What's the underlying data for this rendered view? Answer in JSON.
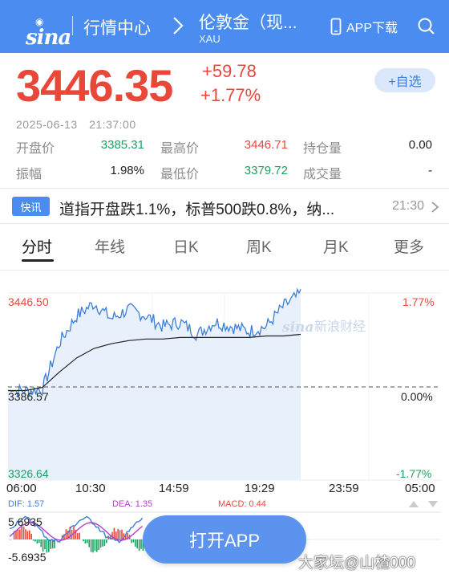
{
  "header": {
    "logo_text": "sina",
    "section_title": "行情中心",
    "stock_name": "伦敦金（现...",
    "stock_code": "XAU",
    "app_download_label": "APP下载"
  },
  "quote": {
    "price": "3446.35",
    "change": "+59.78",
    "change_pct": "+1.77%",
    "add_watch_label": "+自选",
    "timestamp": "2025-06-13　21:37:00",
    "stats": {
      "open_label": "开盘价",
      "open_value": "3385.31",
      "high_label": "最高价",
      "high_value": "3446.71",
      "oi_label": "持仓量",
      "oi_value": "0.00",
      "amplitude_label": "振幅",
      "amplitude_value": "1.98%",
      "low_label": "最低价",
      "low_value": "3379.72",
      "volume_label": "成交量",
      "volume_value": "-"
    }
  },
  "news": {
    "tag": "快讯",
    "text": "道指开盘跌1.1%，标普500跌0.8%，纳...",
    "time": "21:30"
  },
  "tabs": [
    "分时",
    "年线",
    "日K",
    "周K",
    "月K",
    "更多"
  ],
  "chart": {
    "price_top": "3446.50",
    "price_mid": "3386.57",
    "price_bottom": "3326.64",
    "pct_top": "1.77%",
    "pct_mid": "0.00%",
    "pct_bottom": "-1.77%",
    "watermark": "新浪财经",
    "times": [
      "06:00",
      "10:30",
      "14:59",
      "19:29",
      "23:59",
      "05:00"
    ],
    "colors": {
      "line": "#3d7fd6",
      "avg": "#222222",
      "fill": "#e8f0fb",
      "up": "#e9473a",
      "down": "#1aa260"
    }
  },
  "chart_data": {
    "type": "line",
    "title": "",
    "xlabel": "",
    "ylabel": "",
    "x": [
      "06:00",
      "10:30",
      "14:59",
      "19:29",
      "23:59",
      "05:00"
    ],
    "ylim": [
      3326.64,
      3446.5
    ],
    "series": [
      {
        "name": "",
        "values": [
          3384,
          3384,
          3385,
          3415,
          3432,
          3440,
          3430,
          3436,
          3432,
          3425,
          3428,
          3420,
          3428,
          3425,
          3422,
          3425,
          3438,
          3446
        ]
      },
      {
        "name": "",
        "values": [
          3384,
          3384,
          3386,
          3396,
          3405,
          3411,
          3414,
          3416,
          3417,
          3417,
          3418,
          3418,
          3418,
          3418,
          3418,
          3419,
          3419,
          3420
        ]
      }
    ]
  },
  "indicators": {
    "dif_label": "DIF: 1.57",
    "dea_label": "DEA: 1.35",
    "macd_label": "MACD: 0.44",
    "top_value": "5.6935",
    "bottom_value": "-5.6935"
  },
  "open_app_label": "打开APP",
  "user_watermark": "大家坛@山楂000"
}
